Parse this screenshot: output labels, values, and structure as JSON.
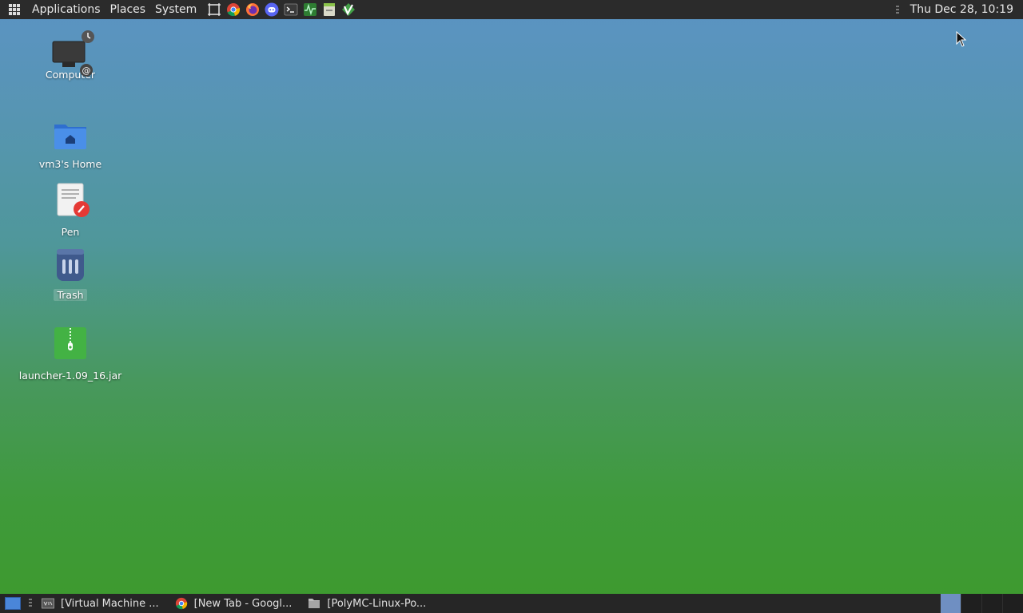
{
  "top_panel": {
    "menus": [
      {
        "label": "Applications"
      },
      {
        "label": "Places"
      },
      {
        "label": "System"
      }
    ],
    "launchers": [
      {
        "icon": "screenshot-icon"
      },
      {
        "icon": "chrome-icon"
      },
      {
        "icon": "firefox-icon"
      },
      {
        "icon": "discord-icon"
      },
      {
        "icon": "terminal-icon"
      },
      {
        "icon": "system-monitor-icon"
      },
      {
        "icon": "text-editor-icon"
      },
      {
        "icon": "vim-icon"
      }
    ],
    "clock": "Thu Dec 28, 10:19"
  },
  "desktop": {
    "icons": [
      {
        "label": "Computer",
        "icon": "computer-icon"
      },
      {
        "label": "vm3's Home",
        "icon": "home-folder-icon"
      },
      {
        "label": "Pen",
        "icon": "pen-document-icon"
      },
      {
        "label": "Trash",
        "icon": "trash-icon"
      },
      {
        "label": "launcher-1.09_16.jar",
        "icon": "jar-archive-icon"
      }
    ]
  },
  "taskbar": {
    "tasks": [
      {
        "label": "[Virtual Machine ...",
        "icon": "vmware-icon"
      },
      {
        "label": "[New Tab - Googl...",
        "icon": "chrome-icon"
      },
      {
        "label": "[PolyMC-Linux-Po...",
        "icon": "folder-icon"
      }
    ],
    "workspaces": 4,
    "active_workspace": 1
  },
  "colors": {
    "panel": "#2b2b2b",
    "desktop_top": "#5b93c4",
    "desktop_bottom": "#3d9a2d",
    "active_workspace": "#6f8fc2"
  }
}
